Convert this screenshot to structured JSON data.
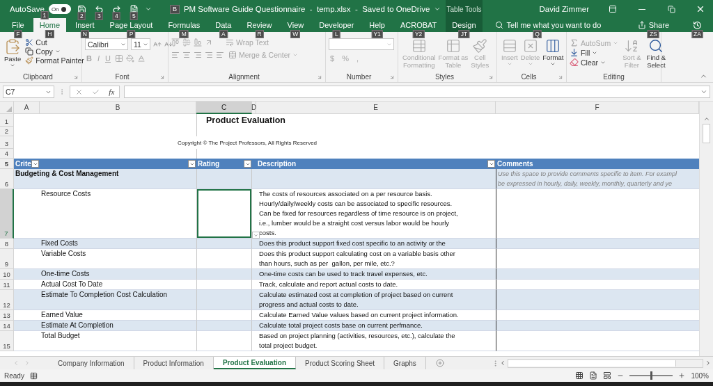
{
  "title_bar": {
    "autosave_label": "AutoSave",
    "autosave": {
      "on": true,
      "text": "On",
      "key": "1"
    },
    "quick_access_keys": [
      "2",
      "3",
      "4",
      "5"
    ],
    "title_key": "B",
    "title": "PM Software Guide Questionnaire  -  temp.xlsx  -  Saved to OneDrive",
    "contextual_label": "Table Tools",
    "user": "David Zimmer"
  },
  "ribbon_tabs": [
    {
      "label": "File",
      "key": "F",
      "selected": false,
      "contextual": false
    },
    {
      "label": "Home",
      "key": "H",
      "selected": true,
      "contextual": false
    },
    {
      "label": "Insert",
      "key": "N",
      "selected": false,
      "contextual": false
    },
    {
      "label": "Page Layout",
      "key": "P",
      "selected": false,
      "contextual": false
    },
    {
      "label": "Formulas",
      "key": "M",
      "selected": false,
      "contextual": false
    },
    {
      "label": "Data",
      "key": "A",
      "selected": false,
      "contextual": false
    },
    {
      "label": "Review",
      "key": "R",
      "selected": false,
      "contextual": false
    },
    {
      "label": "View",
      "key": "W",
      "selected": false,
      "contextual": false
    },
    {
      "label": "Developer",
      "key": "L",
      "selected": false,
      "contextual": false
    },
    {
      "label": "Help",
      "key": "Y1",
      "selected": false,
      "contextual": false
    },
    {
      "label": "ACROBAT",
      "key": "Y2",
      "selected": false,
      "contextual": false
    },
    {
      "label": "Design",
      "key": "JT",
      "selected": false,
      "contextual": true
    }
  ],
  "tell_me": {
    "placeholder": "Tell me what you want to do",
    "key": "Q"
  },
  "share": {
    "label": "Share",
    "key": "ZS"
  },
  "comments_key": "ZA",
  "ribbon": {
    "clipboard": {
      "label": "Clipboard",
      "paste": "Paste",
      "cut": "Cut",
      "copy": "Copy",
      "format_painter": "Format Painter"
    },
    "font": {
      "label": "Font",
      "font_name": "Calibri",
      "font_size": "11",
      "styles": [
        {
          "label": "B",
          "disabled": true
        },
        {
          "label": "I",
          "disabled": true
        },
        {
          "label": "U",
          "disabled": true
        }
      ]
    },
    "alignment": {
      "label": "Alignment",
      "wrap_text": {
        "label": "Wrap Text",
        "disabled": true
      },
      "merge": {
        "label": "Merge & Center",
        "disabled": true
      }
    },
    "number": {
      "label": "Number",
      "symbols": [
        "$",
        "%",
        ","
      ]
    },
    "styles": {
      "label": "Styles",
      "buttons": [
        {
          "label": "Conditional\nFormatting",
          "disabled": true
        },
        {
          "label": "Format as\nTable",
          "disabled": true
        },
        {
          "label": "Cell\nStyles",
          "disabled": true
        }
      ]
    },
    "cells": {
      "label": "Cells",
      "buttons": [
        {
          "label": "Insert",
          "disabled": true
        },
        {
          "label": "Delete",
          "disabled": true
        },
        {
          "label": "Format",
          "disabled": false
        }
      ]
    },
    "editing": {
      "label": "Editing",
      "autosum": {
        "label": "AutoSum",
        "disabled": true
      },
      "fill": {
        "label": "Fill",
        "disabled": false
      },
      "clear": {
        "label": "Clear",
        "disabled": false
      },
      "sort_filter": {
        "label": "Sort &\nFilter",
        "disabled": true
      },
      "find_select": {
        "label": "Find &\nSelect",
        "disabled": false
      }
    }
  },
  "formula_bar": {
    "name_box": "C7",
    "function_label": "fx"
  },
  "sheet": {
    "columns": [
      {
        "label": "A",
        "selected": false
      },
      {
        "label": "B",
        "selected": false
      },
      {
        "label": "C",
        "selected": true
      },
      {
        "label": "D",
        "selected": false
      },
      {
        "label": "E",
        "selected": false
      },
      {
        "label": "F",
        "selected": false
      }
    ],
    "top_row_numbers": [
      "1",
      "2",
      "3",
      "4",
      "5"
    ],
    "title": "Product Evaluation",
    "copyright": "Copyright © The Project Professors, All Rights Reserved",
    "table_headers": [
      "Crite",
      "Rating",
      "Description",
      "Comments"
    ],
    "rows": [
      {
        "number": "6",
        "kind": "section",
        "criterion": "Budgeting & Cost Management",
        "rating_selected": false,
        "comment": "Use this space to provide comments specific to item. For exampl\nbe expressed in hourly, daily, weekly, monthly, quarterly and ye"
      },
      {
        "number": "7",
        "kind": "item",
        "criterion": "Resource Costs",
        "rating_selected": true,
        "description": "The costs of resources associated on a per resource basis.\nHourly/daily/weekly costs can be associated to specific resources.\nCan be fixed for resources regardless of time resource is on project,\ni.e., lumber would be a straight cost versus labor would be hourly\ncosts."
      },
      {
        "number": "8",
        "kind": "item",
        "criterion": "Fixed Costs",
        "rating_selected": false,
        "description": "Does this product support fixed cost specific to an activity or the"
      },
      {
        "number": "9",
        "kind": "item",
        "criterion": "Variable Costs",
        "rating_selected": false,
        "description": "Does this product support calculating cost on a variable basis other\nthan hours, such as per  gallon, per mile, etc.?"
      },
      {
        "number": "10",
        "kind": "item",
        "criterion": "One-time Costs",
        "rating_selected": false,
        "description": "One-time costs can be used to track travel expenses, etc."
      },
      {
        "number": "11",
        "kind": "item",
        "criterion": "Actual Cost To Date",
        "rating_selected": false,
        "description": "Track, calculate and report actual costs to date."
      },
      {
        "number": "12",
        "kind": "item",
        "criterion": "Estimate To Completion Cost Calculation",
        "rating_selected": false,
        "description": "Calculate estimated cost at completion of project based on current\nprogress and actual costs to date."
      },
      {
        "number": "13",
        "kind": "item",
        "criterion": "Earned Value",
        "rating_selected": false,
        "description": "Calculate Earned Value values based on current project information."
      },
      {
        "number": "14",
        "kind": "item",
        "criterion": "Estimate At Completion",
        "rating_selected": false,
        "description": "Calculate total project costs base on current perfmance."
      },
      {
        "number": "15",
        "kind": "item",
        "criterion": "Total Budget",
        "rating_selected": false,
        "description": "Based on project planning (activities, resources, etc.), calculate the\ntotal project budget."
      }
    ]
  },
  "sheet_tabs": [
    {
      "label": "Company Information",
      "selected": false
    },
    {
      "label": "Product Information",
      "selected": false
    },
    {
      "label": "Product Evaluation",
      "selected": true
    },
    {
      "label": "Product Scoring Sheet",
      "selected": false
    },
    {
      "label": "Graphs",
      "selected": false
    }
  ],
  "status_bar": {
    "status": "Ready",
    "zoom": {
      "level": 0.5,
      "reading": "100%"
    }
  }
}
